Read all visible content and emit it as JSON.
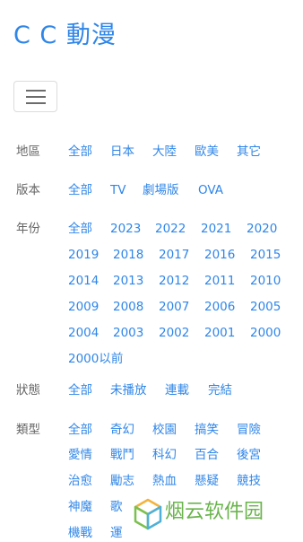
{
  "header": {
    "brand": "C C 動漫"
  },
  "nav": {
    "toggler_icon": "hamburger-icon"
  },
  "filters": [
    {
      "label": "地區",
      "options": [
        "全部",
        "日本",
        "大陸",
        "歐美",
        "其它"
      ]
    },
    {
      "label": "版本",
      "options": [
        "全部",
        "TV",
        "劇場版",
        "OVA"
      ]
    },
    {
      "label": "年份",
      "options": [
        "全部",
        "2023",
        "2022",
        "2021",
        "2020",
        "2019",
        "2018",
        "2017",
        "2016",
        "2015",
        "2014",
        "2013",
        "2012",
        "2011",
        "2010",
        "2009",
        "2008",
        "2007",
        "2006",
        "2005",
        "2004",
        "2003",
        "2002",
        "2001",
        "2000",
        "2000以前"
      ]
    },
    {
      "label": "狀態",
      "options": [
        "全部",
        "未播放",
        "連載",
        "完結"
      ]
    },
    {
      "label": "類型",
      "options": [
        "全部",
        "奇幻",
        "校園",
        "搞笑",
        "冒險",
        "愛情",
        "戰鬥",
        "科幻",
        "百合",
        "後宮",
        "治愈",
        "勵志",
        "熱血",
        "懸疑",
        "競技",
        "神魔",
        "歌",
        "機戰",
        "運"
      ]
    }
  ],
  "watermark": {
    "text": "烟云软件园"
  },
  "colors": {
    "link": "#2f86e8",
    "label": "#666666",
    "watermark": "#6ab44c"
  }
}
